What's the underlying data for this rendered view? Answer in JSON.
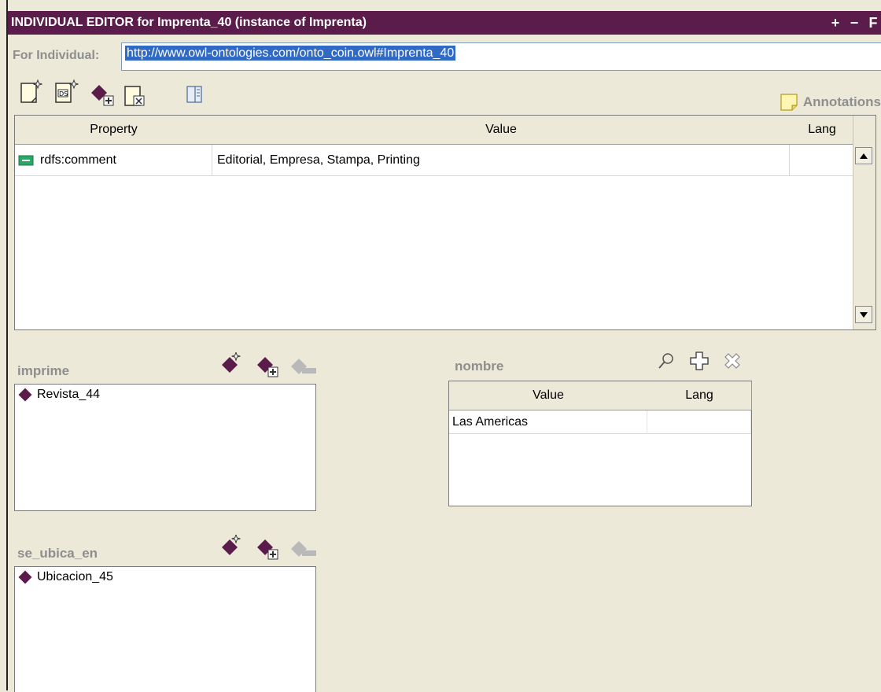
{
  "window": {
    "title": "INDIVIDUAL EDITOR for Imprenta_40   (instance of Imprenta)",
    "buttons": [
      "+",
      "−",
      "F"
    ]
  },
  "individual": {
    "label": "For Individual:",
    "uri": "http://www.owl-ontologies.com/onto_coin.owl#Imprenta_40"
  },
  "toolbar": {
    "annotations_label": "Annotations"
  },
  "main_table": {
    "columns": [
      "Property",
      "Value",
      "Lang"
    ],
    "rows": [
      {
        "property": "rdfs:comment",
        "value": "Editorial, Empresa, Stampa, Printing",
        "lang": ""
      }
    ]
  },
  "imprime": {
    "label": "imprime",
    "items": [
      "Revista_44"
    ]
  },
  "se_ubica_en": {
    "label": "se_ubica_en",
    "items": [
      "Ubicacion_45"
    ]
  },
  "nombre": {
    "label": "nombre",
    "columns": [
      "Value",
      "Lang"
    ],
    "rows": [
      {
        "value": "Las Americas",
        "lang": ""
      }
    ]
  },
  "colors": {
    "title_bar": "#5b1c4b",
    "background": "#ece9d8",
    "selection": "#316ac5",
    "label_gray": "#8e8e8e"
  }
}
